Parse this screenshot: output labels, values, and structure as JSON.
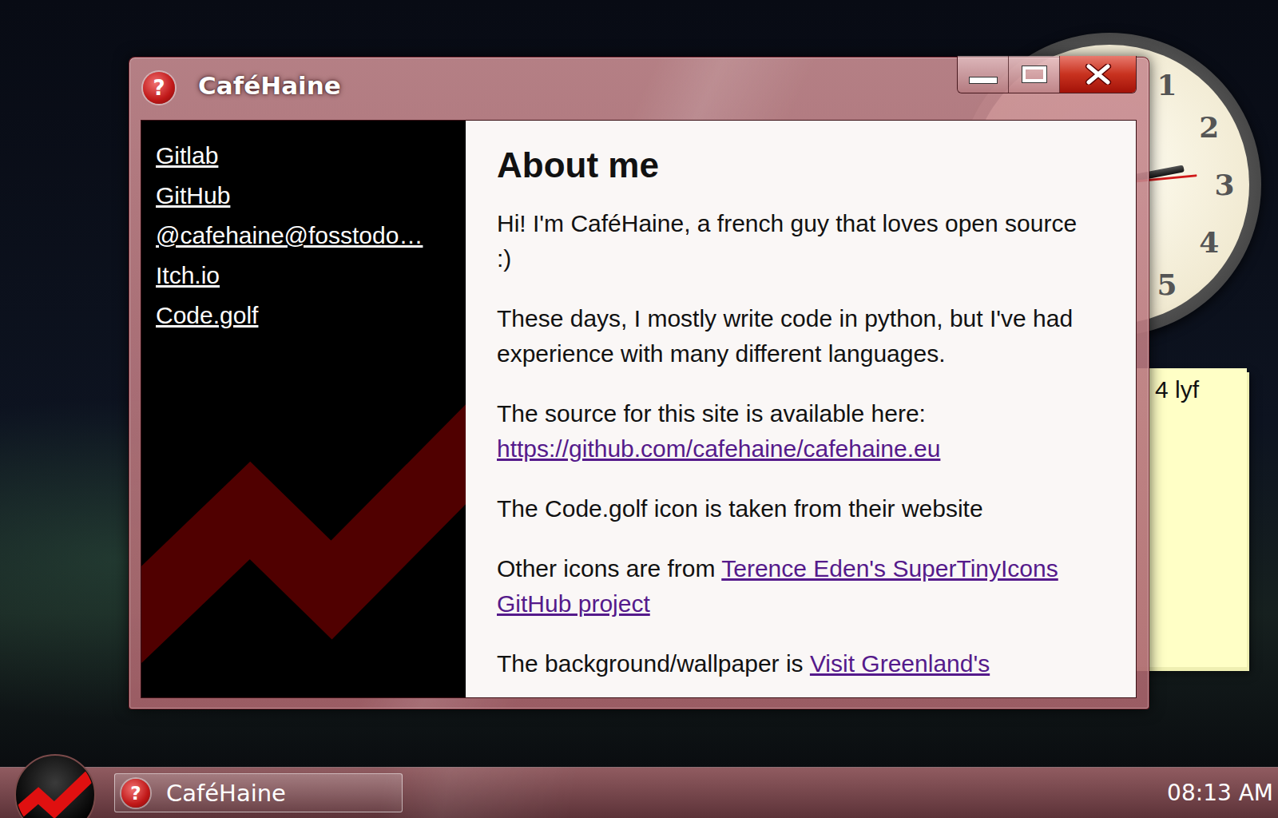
{
  "window": {
    "title": "CaféHaine",
    "icon": "?"
  },
  "sidebar": {
    "links": [
      "Gitlab",
      "GitHub",
      "@cafehaine@fosstodo…",
      "Itch.io",
      "Code.golf"
    ]
  },
  "content": {
    "heading": "About me",
    "paragraphs": [
      [
        {
          "text": "Hi! I'm CaféHaine, a french guy that loves open source :)",
          "link": false
        }
      ],
      [
        {
          "text": "These days, I mostly write code in python, but I've had experience with many different languages.",
          "link": false
        }
      ],
      [
        {
          "text": "The source for this site is available here: ",
          "link": false
        },
        {
          "text": "https://github.com/cafehaine/cafehaine.eu",
          "link": true
        }
      ],
      [
        {
          "text": "The Code.golf icon is taken from their website",
          "link": false
        }
      ],
      [
        {
          "text": "Other icons are from ",
          "link": false
        },
        {
          "text": "Terence Eden's SuperTinyIcons GitHub project",
          "link": true
        }
      ],
      [
        {
          "text": "The background/wallpaper is ",
          "link": false
        },
        {
          "text": "Visit Greenland's",
          "link": true
        }
      ]
    ]
  },
  "clock_gadget": {
    "numbers": [
      "1",
      "2",
      "3",
      "4",
      "5"
    ],
    "hands": [
      {
        "kind": "minute",
        "level": 0.22
      },
      {
        "kind": "second",
        "level": 0.235
      }
    ]
  },
  "sticky_note": {
    "text": "4 lyf"
  },
  "taskbar": {
    "items": [
      {
        "label": "CaféHaine",
        "icon": "?",
        "selected": false
      }
    ],
    "clock": "08:13 AM"
  }
}
